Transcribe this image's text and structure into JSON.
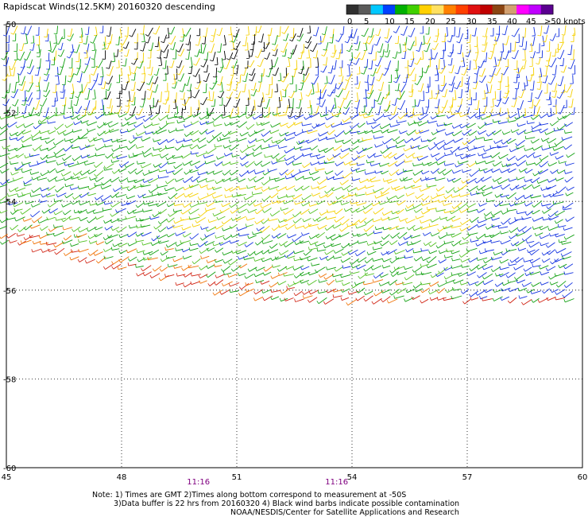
{
  "title": "Rapidscat Winds(12.5KM) 20160320 descending",
  "legend": {
    "labels": [
      "0",
      "5",
      "10",
      "15",
      "20",
      "25",
      "30",
      "35",
      "40",
      "45",
      ">50 knots"
    ],
    "colors": [
      "#303030",
      "#5a5a5a",
      "#00c8ff",
      "#0040ff",
      "#00b000",
      "#40d000",
      "#ffd000",
      "#ffe060",
      "#ff8000",
      "#ff4000",
      "#e01010",
      "#c00000",
      "#8b4513",
      "#d2a070",
      "#ff00ff",
      "#c000ff",
      "#5a0090"
    ]
  },
  "axes": {
    "x_ticks": [
      "45",
      "48",
      "51",
      "54",
      "57",
      "60"
    ],
    "x_values": [
      45,
      48,
      51,
      54,
      57,
      60
    ],
    "y_ticks": [
      "-50",
      "-52",
      "-54",
      "-56",
      "-58",
      "-60"
    ],
    "y_values": [
      -50,
      -52,
      -54,
      -56,
      -58,
      -60
    ],
    "x_range": [
      45,
      60
    ],
    "y_range": [
      -50,
      -60
    ]
  },
  "time_labels": [
    {
      "text": "11:16",
      "lon": 50.0
    },
    {
      "text": "11:16",
      "lon": 53.6
    }
  ],
  "notes": {
    "line1": "Note: 1) Times are GMT 2)Times along bottom correspond to measurement at -50S",
    "line2": "3)Data buffer is 22 hrs from 20160320 4) Black wind barbs indicate possible contamination",
    "line3": "NOAA/NESDIS/Center for Satellite Applications and Research"
  },
  "swath_colors": {
    "black": "#000000",
    "blue": "#1030e0",
    "green": "#10a010",
    "lightgreen": "#50c020",
    "yellow": "#f5d000",
    "orange": "#f07000",
    "red": "#d02010"
  }
}
